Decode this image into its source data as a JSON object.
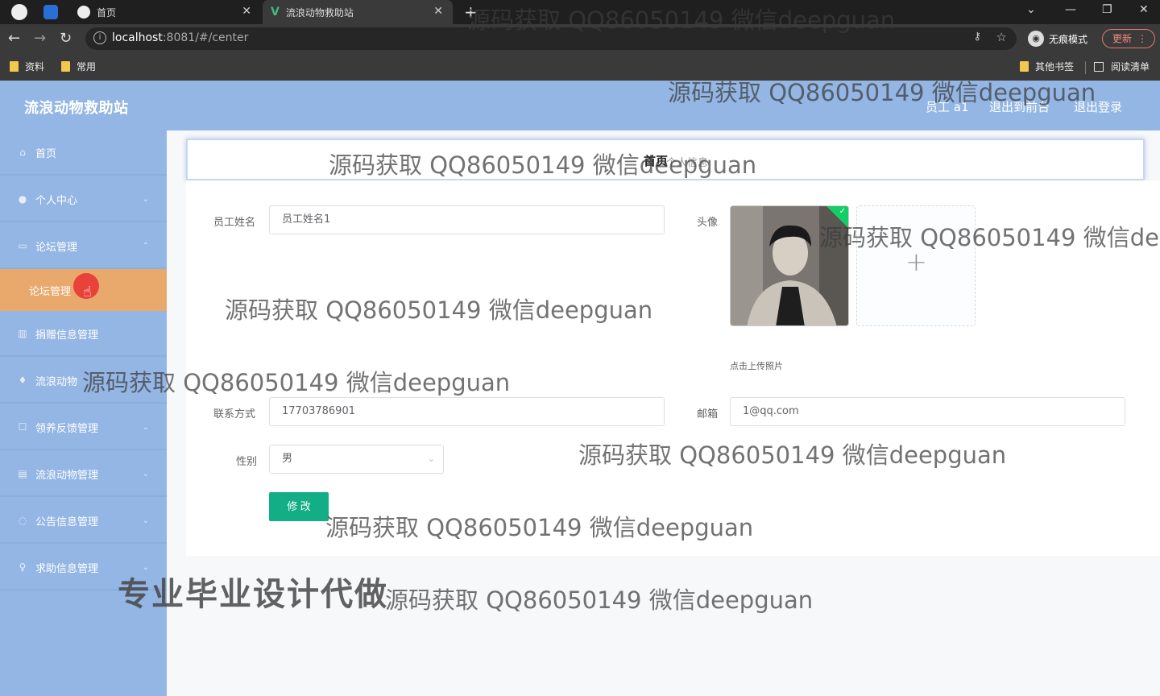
{
  "browser": {
    "tabs": [
      {
        "title": "首页",
        "active": false
      },
      {
        "title": "流浪动物救助站",
        "active": true
      }
    ],
    "url_host": "localhost",
    "url_rest": ":8081/#/center",
    "incognito_label": "无痕模式",
    "update_label": "更新",
    "bookmarks": [
      "资料",
      "常用"
    ],
    "other_bookmarks": "其他书签",
    "reading_list": "阅读清单"
  },
  "header": {
    "brand": "流浪动物救助站",
    "user": "员工 a1",
    "back_front": "退出到前台",
    "logout": "退出登录"
  },
  "sidebar": {
    "items": [
      {
        "label": "首页",
        "icon": "home-icon"
      },
      {
        "label": "个人中心",
        "icon": "user-icon"
      },
      {
        "label": "论坛管理",
        "icon": "forum-icon"
      },
      {
        "label": "捐赠信息管理",
        "icon": "bar-chart-icon"
      },
      {
        "label": "流浪动物",
        "icon": "pet-icon"
      },
      {
        "label": "领养反馈管理",
        "icon": "feedback-icon"
      },
      {
        "label": "流浪动物管理",
        "icon": "list-icon"
      },
      {
        "label": "公告信息管理",
        "icon": "notice-icon"
      },
      {
        "label": "求助信息管理",
        "icon": "help-icon"
      }
    ],
    "sub_item": "论坛管理"
  },
  "breadcrumb": {
    "home": "首页",
    "current": "个人信息"
  },
  "form": {
    "name_label": "员工姓名",
    "name_value": "员工姓名1",
    "avatar_label": "头像",
    "upload_tip": "点击上传照片",
    "phone_label": "联系方式",
    "phone_value": "17703786901",
    "email_label": "邮箱",
    "email_value": "1@qq.com",
    "gender_label": "性别",
    "gender_value": "男",
    "submit_label": "修 改"
  },
  "watermarks": {
    "text": "源码获取 QQ86050149 微信deepguan",
    "text_cut": "源码获取 QQ86050149 微信de",
    "promo": "专业毕业设计代做"
  },
  "colors": {
    "header_bg": "#94b6e4",
    "active_menu": "#e9a96c",
    "submit_btn": "#13ad86"
  }
}
